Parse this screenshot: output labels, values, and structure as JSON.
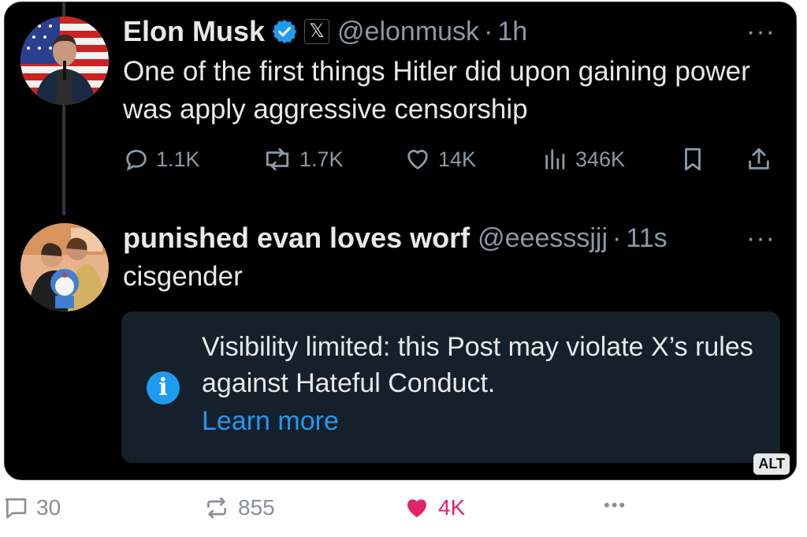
{
  "tweet1": {
    "name": "Elon Musk",
    "x_badge": "𝕏",
    "handle": "@elonmusk",
    "dot": "·",
    "time": "1h",
    "more": "···",
    "text": "One of the first things Hitler did upon gaining power was apply aggressive censorship",
    "actions": {
      "reply": "1.1K",
      "repost": "1.7K",
      "like": "14K",
      "views": "346K"
    }
  },
  "tweet2": {
    "name": "punished evan loves worf",
    "handle": "@eeesssjjj",
    "dot": "·",
    "time": "11s",
    "more": "···",
    "text": "cisgender",
    "notice": {
      "icon": "i",
      "text": "Visibility limited: this Post may violate X’s rules against Hateful Conduct.",
      "link": "Learn more"
    }
  },
  "alt_badge": "ALT",
  "outer_actions": {
    "reply": "30",
    "repost": "855",
    "like": "4K",
    "more": "•••"
  },
  "colors": {
    "accent": "#1d9bf0",
    "like": "#e0246c",
    "secondary": "#8b98a5"
  }
}
